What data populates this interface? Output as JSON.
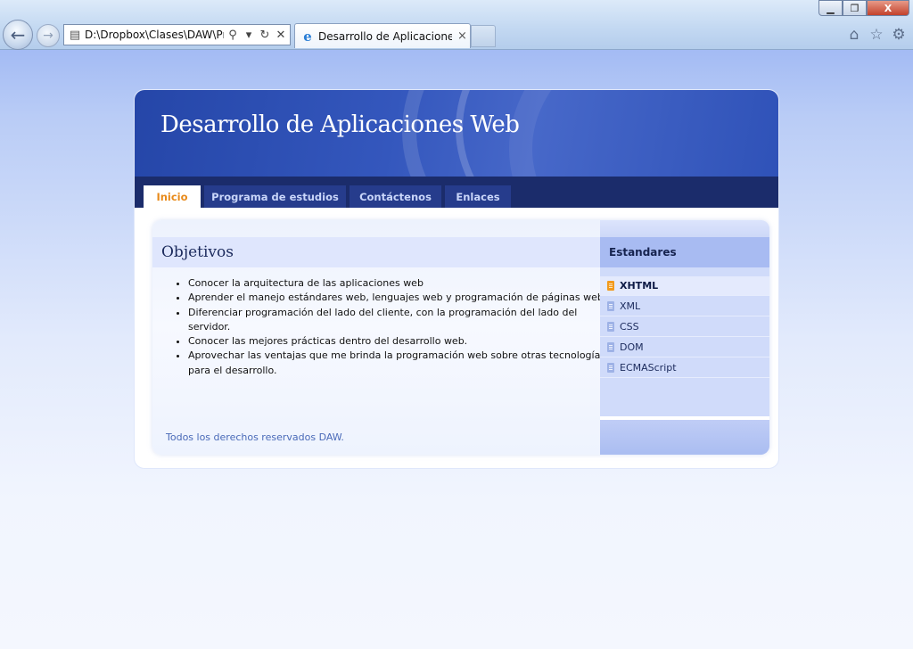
{
  "browser": {
    "address_url": "D:\\Dropbox\\Clases\\DAW\\Prac",
    "address_icons": {
      "search": "⚲",
      "dropdown": "▾",
      "refresh": "↻",
      "stop": "✕"
    },
    "tab_title": "Desarrollo de Aplicaciones ...",
    "tab_close": "×",
    "window_buttons": {
      "minimize": "▁",
      "maximize": "❐",
      "close": "X"
    },
    "toolbar_icons": [
      "home-icon",
      "star-icon",
      "gear-icon"
    ],
    "glyphs": {
      "back": "←",
      "forward": "→",
      "home": "⌂",
      "star": "☆",
      "gear": "⚙",
      "ie": "e",
      "page": "▤"
    }
  },
  "site": {
    "title": "Desarrollo de Aplicaciones Web",
    "nav": [
      "Inicio",
      "Programa de estudios",
      "Contáctenos",
      "Enlaces"
    ],
    "active_nav": "Inicio"
  },
  "main": {
    "heading": "Objetivos",
    "objectives": [
      "Conocer la arquitectura de las aplicaciones web",
      "Aprender el manejo estándares web, lenguajes web y programación de páginas web.",
      "Diferenciar programación del lado del cliente, con la programación del lado del servidor.",
      "Conocer las mejores prácticas dentro del desarrollo web.",
      "Aprovechar las ventajas que me brinda la programación web sobre otras tecnologías para el desarrollo."
    ],
    "footer": "Todos los derechos reservados DAW."
  },
  "sidebar": {
    "heading": "Estandares",
    "items": [
      "XHTML",
      "XML",
      "CSS",
      "DOM",
      "ECMAScript"
    ],
    "active_item": "XHTML"
  },
  "colors": {
    "banner": "#2546a8",
    "navbar": "#1b2c6b",
    "nav_tab": "#263c8c",
    "active_tab_text": "#e88a1a",
    "sidebar": "#d0dbfa",
    "heading_bg": "#dfe6fd"
  }
}
